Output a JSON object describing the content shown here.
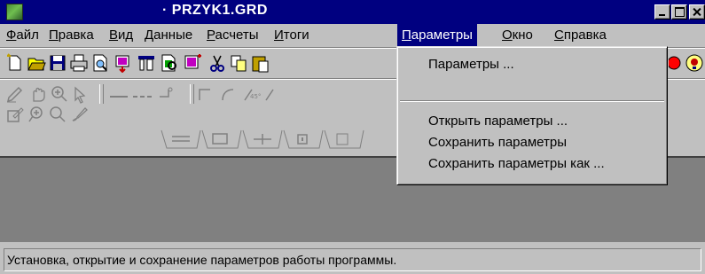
{
  "window": {
    "title": "· PRZYK1.GRD",
    "buttons": [
      "minimize",
      "maximize",
      "close"
    ]
  },
  "menu": [
    {
      "label": "Файл",
      "accel": "Ф",
      "rest": "айл"
    },
    {
      "label": "Правка",
      "accel": "П",
      "rest": "равка"
    },
    {
      "label": "Вид",
      "accel": "В",
      "rest": "ид"
    },
    {
      "label": "Данные",
      "accel": "Д",
      "rest": "анные"
    },
    {
      "label": "Расчеты",
      "accel": "Р",
      "rest": "асчеты"
    },
    {
      "label": "Итоги",
      "accel": "И",
      "rest": "тоги"
    },
    {
      "label": "Параметры",
      "accel": "П",
      "rest": "араметры"
    },
    {
      "label": "Окно",
      "accel": "О",
      "rest": "кно"
    },
    {
      "label": "Справка",
      "accel": "С",
      "rest": "правка"
    }
  ],
  "active_menu": "Параметры",
  "dropdown": {
    "items": [
      {
        "label": "Параметры ..."
      },
      {
        "label": "Открыть параметры ..."
      },
      {
        "label": "Сохранить параметры"
      },
      {
        "label": "Сохранить параметры как ..."
      }
    ]
  },
  "toolbar1": [
    "new-file-icon",
    "open-folder-icon",
    "save-icon",
    "print-icon",
    "print-preview-icon",
    "import-icon",
    "export-icon",
    "find-icon",
    "insert-icon",
    "cut-icon",
    "copy-icon",
    "paste-icon"
  ],
  "toolbar1_right": [
    "stop-icon",
    "help-icon"
  ],
  "toolbar2": [
    "edit-pen-icon",
    "hand-pan-icon",
    "zoom-in-icon",
    "select-arrow-icon",
    "line-solid-icon",
    "line-dashed-icon",
    "line-corner-icon",
    "angle-90-icon",
    "arc-icon",
    "angle-45-icon",
    "angle-custom-icon"
  ],
  "toolbar3": [
    "edit-table-icon",
    "zoom-plus-icon",
    "zoom-minus-icon",
    "brush-icon"
  ],
  "tabs": [
    "tab-lines",
    "tab-frame",
    "tab-nodes",
    "tab-points",
    "tab-grid"
  ],
  "status": {
    "text": "Установка, открытие и сохранение параметров работы программы."
  },
  "colors": {
    "titlebar": "#000080",
    "face": "#c0c0c0",
    "workspace": "#808080",
    "highlight": "#000080"
  }
}
